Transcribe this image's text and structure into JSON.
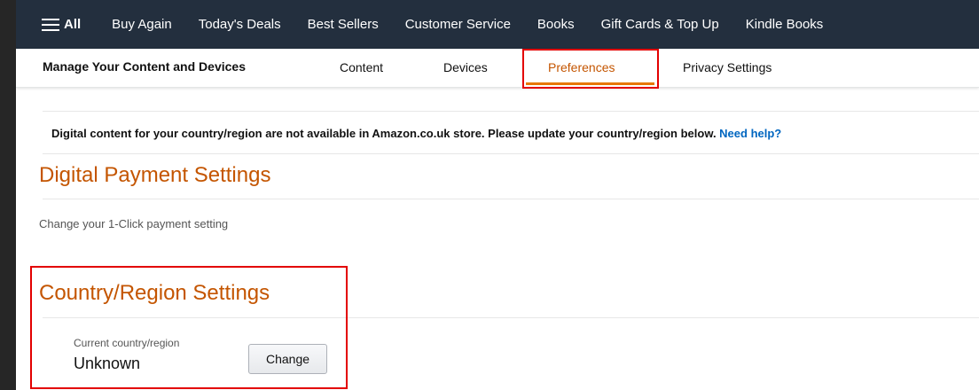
{
  "topnav": {
    "all_label": "All",
    "items": [
      "Buy Again",
      "Today's Deals",
      "Best Sellers",
      "Customer Service",
      "Books",
      "Gift Cards & Top Up",
      "Kindle Books"
    ]
  },
  "subnav": {
    "brand": "Manage Your Content and Devices",
    "tabs": {
      "content": "Content",
      "devices": "Devices",
      "preferences": "Preferences",
      "privacy": "Privacy Settings"
    }
  },
  "notice": {
    "text": "Digital content for your country/region are not available in Amazon.co.uk store. Please update your country/region below. ",
    "link": "Need help?"
  },
  "payment": {
    "title": "Digital Payment Settings",
    "subtitle": "Change your 1-Click payment setting"
  },
  "country": {
    "title": "Country/Region Settings",
    "current_label": "Current country/region",
    "current_value": "Unknown",
    "change_button": "Change"
  },
  "colors": {
    "nav_bg": "#232f3e",
    "accent_orange": "#c45500",
    "highlight_red": "#e30000",
    "link_blue": "#0066c0"
  }
}
